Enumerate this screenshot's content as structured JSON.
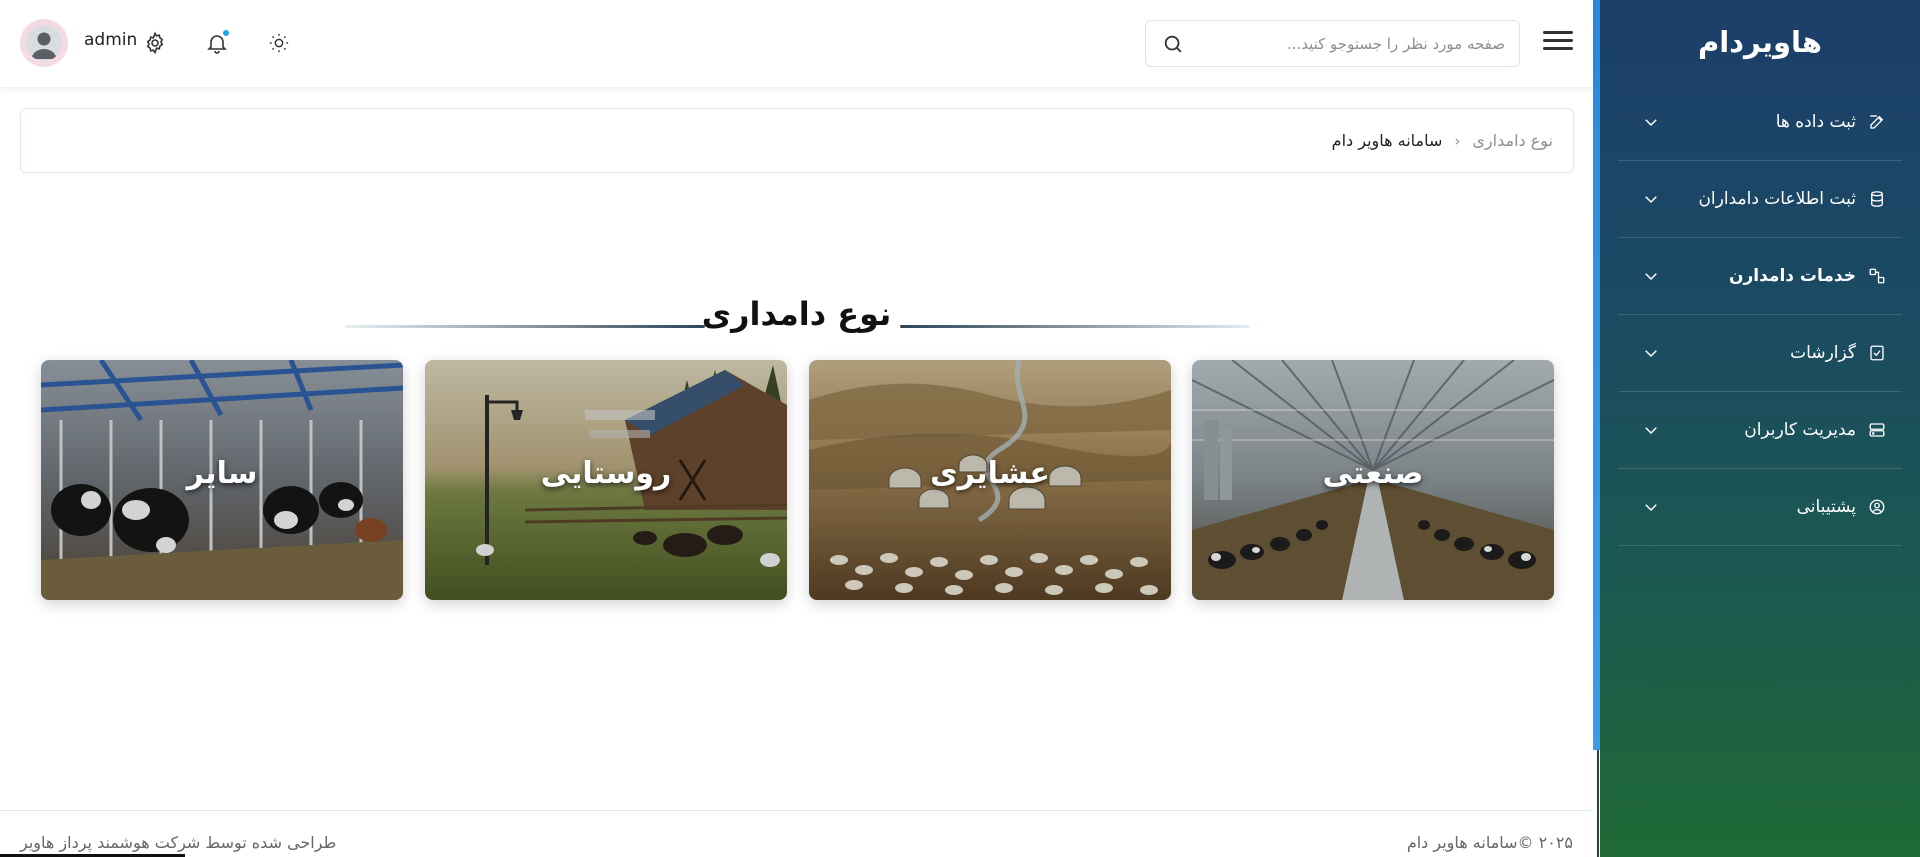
{
  "sidebar": {
    "brand": "هاویردام",
    "items": [
      {
        "label": "ثبت داده ها",
        "icon": "edit-icon"
      },
      {
        "label": "ثبت اطلاعات دامداران",
        "icon": "database-icon"
      },
      {
        "label": "خدمات دامدارن",
        "icon": "services-icon"
      },
      {
        "label": "گزارشات",
        "icon": "report-check-icon"
      },
      {
        "label": "مدیریت کاربران",
        "icon": "server-icon"
      },
      {
        "label": "پشتیبانی",
        "icon": "user-circle-icon"
      }
    ]
  },
  "header": {
    "search_placeholder": "صفحه مورد نظر را جستوجو کنید...",
    "username": "admin"
  },
  "breadcrumb": {
    "current": "نوع دامداری",
    "separator": "‹",
    "root": "سامانه هاویر دام"
  },
  "main": {
    "title": "نوع دامداری",
    "cards": [
      {
        "label": "صنعتی"
      },
      {
        "label": "عشایری"
      },
      {
        "label": "روستایی"
      },
      {
        "label": "سایر"
      }
    ]
  },
  "footer": {
    "copyright": "۲۰۲۵ ©سامانه هاویر دام",
    "credit": "طراحی شده توسط شرکت هوشمند پرداز هاویر"
  },
  "colors": {
    "sidebar_top": "#1c3f6a",
    "sidebar_bottom": "#1f6a35",
    "accent": "#2a8ae0",
    "notification_dot": "#1ea7e8"
  }
}
